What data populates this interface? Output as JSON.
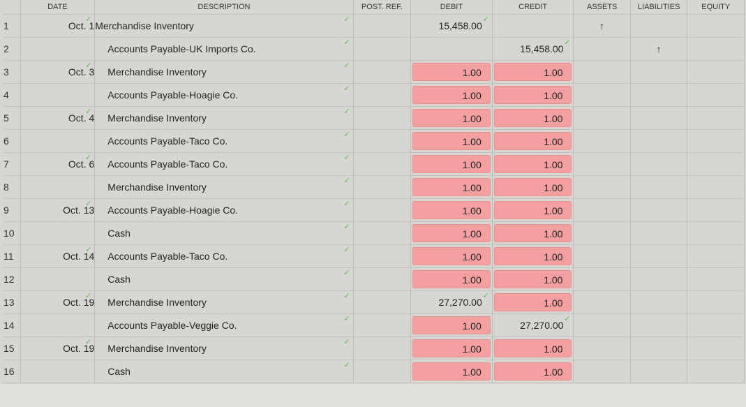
{
  "headers": {
    "date": "DATE",
    "description": "DESCRIPTION",
    "post_ref": "POST. REF.",
    "debit": "DEBIT",
    "credit": "CREDIT",
    "assets": "ASSETS",
    "liabilities": "LIABILITIES",
    "equity": "EQUITY"
  },
  "check_glyph": "✓",
  "icons": {
    "check": "checkmark-icon",
    "arrow": "up-arrow-icon"
  },
  "colors": {
    "error_fill": "#f4a0a0",
    "check": "#5cb85c"
  },
  "rows": [
    {
      "num": "1",
      "date": "Oct. 1",
      "date_check": true,
      "desc": "Merchandise Inventory",
      "indent": false,
      "debit": "15,458.00",
      "debit_error": false,
      "debit_check": true,
      "credit": "",
      "credit_error": false,
      "credit_check": false,
      "assets": "↑",
      "liabilities": "",
      "equity": ""
    },
    {
      "num": "2",
      "date": "",
      "date_check": false,
      "desc": "Accounts Payable-UK Imports Co.",
      "indent": true,
      "debit": "",
      "debit_error": false,
      "debit_check": false,
      "credit": "15,458.00",
      "credit_error": false,
      "credit_check": true,
      "assets": "",
      "liabilities": "↑",
      "equity": ""
    },
    {
      "num": "3",
      "date": "Oct. 3",
      "date_check": true,
      "desc": "Merchandise Inventory",
      "indent": true,
      "debit": "1.00",
      "debit_error": true,
      "debit_check": false,
      "credit": "1.00",
      "credit_error": true,
      "credit_check": false,
      "assets": "",
      "liabilities": "",
      "equity": ""
    },
    {
      "num": "4",
      "date": "",
      "date_check": false,
      "desc": "Accounts Payable-Hoagie Co.",
      "indent": true,
      "debit": "1.00",
      "debit_error": true,
      "debit_check": false,
      "credit": "1.00",
      "credit_error": true,
      "credit_check": false,
      "assets": "",
      "liabilities": "",
      "equity": ""
    },
    {
      "num": "5",
      "date": "Oct. 4",
      "date_check": true,
      "desc": "Merchandise Inventory",
      "indent": true,
      "debit": "1.00",
      "debit_error": true,
      "debit_check": false,
      "credit": "1.00",
      "credit_error": true,
      "credit_check": false,
      "assets": "",
      "liabilities": "",
      "equity": ""
    },
    {
      "num": "6",
      "date": "",
      "date_check": false,
      "desc": "Accounts Payable-Taco Co.",
      "indent": true,
      "debit": "1.00",
      "debit_error": true,
      "debit_check": false,
      "credit": "1.00",
      "credit_error": true,
      "credit_check": false,
      "assets": "",
      "liabilities": "",
      "equity": ""
    },
    {
      "num": "7",
      "date": "Oct. 6",
      "date_check": true,
      "desc": "Accounts Payable-Taco Co.",
      "indent": true,
      "debit": "1.00",
      "debit_error": true,
      "debit_check": false,
      "credit": "1.00",
      "credit_error": true,
      "credit_check": false,
      "assets": "",
      "liabilities": "",
      "equity": ""
    },
    {
      "num": "8",
      "date": "",
      "date_check": false,
      "desc": "Merchandise Inventory",
      "indent": true,
      "debit": "1.00",
      "debit_error": true,
      "debit_check": false,
      "credit": "1.00",
      "credit_error": true,
      "credit_check": false,
      "assets": "",
      "liabilities": "",
      "equity": ""
    },
    {
      "num": "9",
      "date": "Oct. 13",
      "date_check": true,
      "desc": "Accounts Payable-Hoagie Co.",
      "indent": true,
      "debit": "1.00",
      "debit_error": true,
      "debit_check": false,
      "credit": "1.00",
      "credit_error": true,
      "credit_check": false,
      "assets": "",
      "liabilities": "",
      "equity": ""
    },
    {
      "num": "10",
      "date": "",
      "date_check": false,
      "desc": "Cash",
      "indent": true,
      "debit": "1.00",
      "debit_error": true,
      "debit_check": false,
      "credit": "1.00",
      "credit_error": true,
      "credit_check": false,
      "assets": "",
      "liabilities": "",
      "equity": ""
    },
    {
      "num": "11",
      "date": "Oct. 14",
      "date_check": true,
      "desc": "Accounts Payable-Taco Co.",
      "indent": true,
      "debit": "1.00",
      "debit_error": true,
      "debit_check": false,
      "credit": "1.00",
      "credit_error": true,
      "credit_check": false,
      "assets": "",
      "liabilities": "",
      "equity": ""
    },
    {
      "num": "12",
      "date": "",
      "date_check": false,
      "desc": "Cash",
      "indent": true,
      "debit": "1.00",
      "debit_error": true,
      "debit_check": false,
      "credit": "1.00",
      "credit_error": true,
      "credit_check": false,
      "assets": "",
      "liabilities": "",
      "equity": ""
    },
    {
      "num": "13",
      "date": "Oct. 19",
      "date_check": true,
      "desc": "Merchandise Inventory",
      "indent": true,
      "debit": "27,270.00",
      "debit_error": false,
      "debit_check": true,
      "credit": "1.00",
      "credit_error": true,
      "credit_check": false,
      "assets": "",
      "liabilities": "",
      "equity": ""
    },
    {
      "num": "14",
      "date": "",
      "date_check": false,
      "desc": "Accounts Payable-Veggie Co.",
      "indent": true,
      "debit": "1.00",
      "debit_error": true,
      "debit_check": false,
      "credit": "27,270.00",
      "credit_error": false,
      "credit_check": true,
      "assets": "",
      "liabilities": "",
      "equity": ""
    },
    {
      "num": "15",
      "date": "Oct. 19",
      "date_check": true,
      "desc": "Merchandise Inventory",
      "indent": true,
      "debit": "1.00",
      "debit_error": true,
      "debit_check": false,
      "credit": "1.00",
      "credit_error": true,
      "credit_check": false,
      "assets": "",
      "liabilities": "",
      "equity": ""
    },
    {
      "num": "16",
      "date": "",
      "date_check": false,
      "desc": "Cash",
      "indent": true,
      "debit": "1.00",
      "debit_error": true,
      "debit_check": false,
      "credit": "1.00",
      "credit_error": true,
      "credit_check": false,
      "assets": "",
      "liabilities": "",
      "equity": ""
    }
  ]
}
